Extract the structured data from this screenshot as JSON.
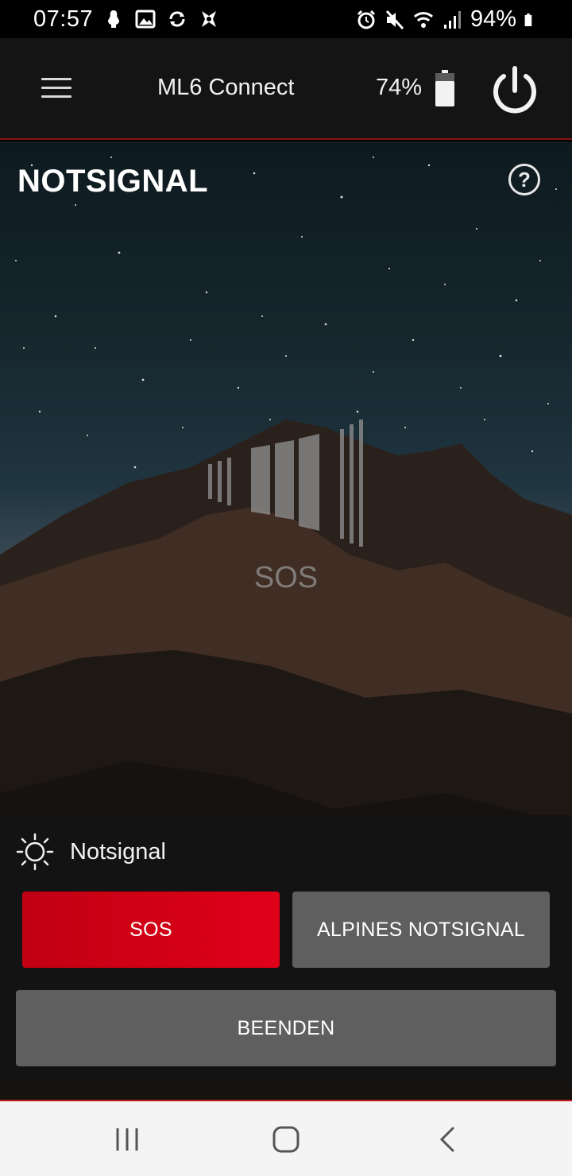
{
  "status_bar": {
    "time": "07:57",
    "battery": "94%",
    "left_icons": [
      "notification-icon",
      "image-icon",
      "sync-icon",
      "app-icon"
    ],
    "right_icons": [
      "alarm-icon",
      "mute-icon",
      "wifi-icon",
      "signal-icon",
      "battery-icon"
    ]
  },
  "header": {
    "title": "ML6 Connect",
    "battery_level": "74%",
    "menu_icon": "menu-icon",
    "power_icon": "power-icon"
  },
  "hero": {
    "title": "NOTSIGNAL",
    "help_label": "?",
    "graphic_caption": "SOS"
  },
  "panel": {
    "icon": "sun-icon",
    "title": "Notsignal",
    "buttons": {
      "sos": "SOS",
      "alpine": "ALPINES NOTSIGNAL",
      "end": "BEENDEN"
    }
  },
  "nav": {
    "recents_icon": "recents-icon",
    "home_icon": "home-icon",
    "back_icon": "back-icon"
  },
  "colors": {
    "accent_red": "#e0001a",
    "button_gray": "#5f5f5f",
    "panel_bg": "#131313"
  }
}
